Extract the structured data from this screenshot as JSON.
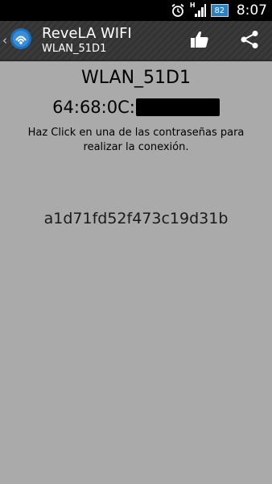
{
  "status_bar": {
    "signal_label": "H",
    "battery_level": "82",
    "time": "8:07"
  },
  "action_bar": {
    "title": "ReveLA WIFI",
    "subtitle": "WLAN_51D1",
    "icons": [
      "chevron-left-icon",
      "app-logo-icon",
      "thumbs-up-icon",
      "share-icon"
    ]
  },
  "network": {
    "ssid": "WLAN_51D1",
    "mac_visible_prefix": "64:68:0C:"
  },
  "instruction": "Haz Click en una de las contraseñas para realizar la conexión.",
  "passwords": [
    "a1d71fd52f473c19d31b"
  ],
  "colors": {
    "background": "#aaaaaa",
    "action_bar": "#3a3a3a",
    "status_bar": "#000000",
    "battery": "#2e7fc0"
  }
}
